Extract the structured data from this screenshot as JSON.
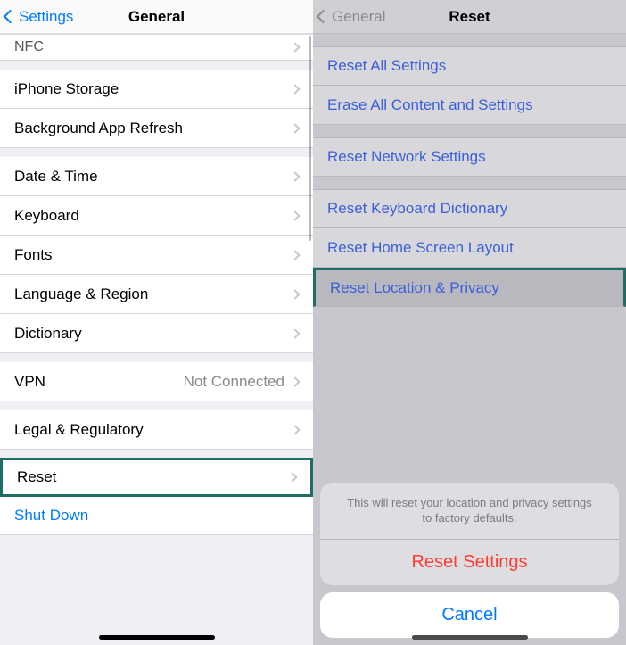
{
  "left": {
    "back": "Settings",
    "title": "General",
    "rows": {
      "nfc": "NFC",
      "iphone_storage": "iPhone Storage",
      "bg_refresh": "Background App Refresh",
      "date_time": "Date & Time",
      "keyboard": "Keyboard",
      "fonts": "Fonts",
      "lang_region": "Language & Region",
      "dictionary": "Dictionary",
      "vpn": "VPN",
      "vpn_value": "Not Connected",
      "legal": "Legal & Regulatory",
      "reset": "Reset",
      "shutdown": "Shut Down"
    }
  },
  "right": {
    "back": "General",
    "title": "Reset",
    "rows": {
      "reset_all": "Reset All Settings",
      "erase_all": "Erase All Content and Settings",
      "reset_network": "Reset Network Settings",
      "reset_keyboard": "Reset Keyboard Dictionary",
      "reset_home": "Reset Home Screen Layout",
      "reset_location": "Reset Location & Privacy"
    },
    "sheet": {
      "message": "This will reset your location and privacy settings to factory defaults.",
      "action": "Reset Settings",
      "cancel": "Cancel"
    }
  }
}
